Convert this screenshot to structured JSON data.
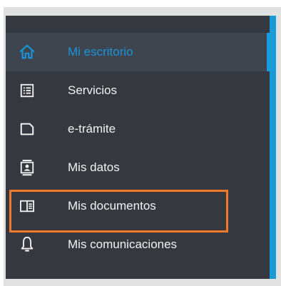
{
  "accent_color": "#1994d8",
  "highlight_color": "#ee7a2e",
  "sidebar_bg": "#35393f",
  "menu": {
    "items": [
      {
        "label": "Mi escritorio",
        "icon": "home-icon",
        "active": true
      },
      {
        "label": "Servicios",
        "icon": "list-icon",
        "active": false
      },
      {
        "label": "e-trámite",
        "icon": "document-icon",
        "active": false
      },
      {
        "label": "Mis datos",
        "icon": "id-card-icon",
        "active": false
      },
      {
        "label": "Mis documentos",
        "icon": "folder-document-icon",
        "active": false,
        "highlighted": true
      },
      {
        "label": "Mis comunicaciones",
        "icon": "bell-icon",
        "active": false
      }
    ]
  }
}
